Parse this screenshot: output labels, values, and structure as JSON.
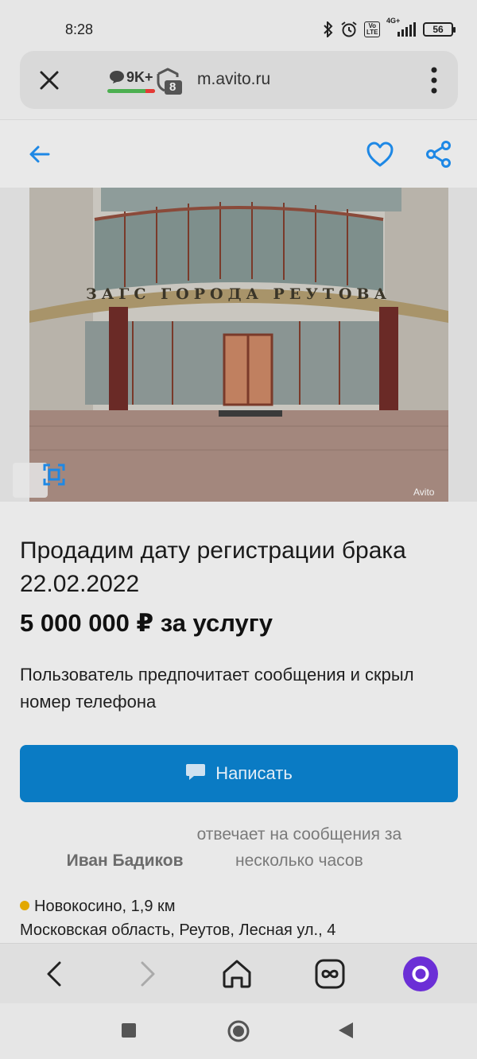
{
  "status_bar": {
    "time": "8:28",
    "network": "4G+",
    "volte": "Vo LTE",
    "battery": "56"
  },
  "browser": {
    "comments_count": "9K+",
    "tabs_count": "8",
    "url": "m.avito.ru"
  },
  "photo": {
    "watermark": "Avito",
    "building_sign": "ЗАГС ГОРОДА РЕУТОВА"
  },
  "listing": {
    "title": "Продадим дату регистрации брака 22.02.2022",
    "price": "5 000 000 ₽ за услугу",
    "contact_preference": "Пользователь предпочитает сообщения и скрыл номер телефона",
    "write_button": "Написать",
    "seller_name": "Иван Бадиков",
    "seller_response": "отвечает на сообщения за несколько часов",
    "metro_station": "Новокосино, 1,9 км",
    "address": "Московская область, Реутов, Лесная ул., 4",
    "metro_color": "#e2a800"
  },
  "colors": {
    "accent": "#0a7bc4",
    "icon_blue": "#1e88e5",
    "alice": "#6b2fd6"
  }
}
